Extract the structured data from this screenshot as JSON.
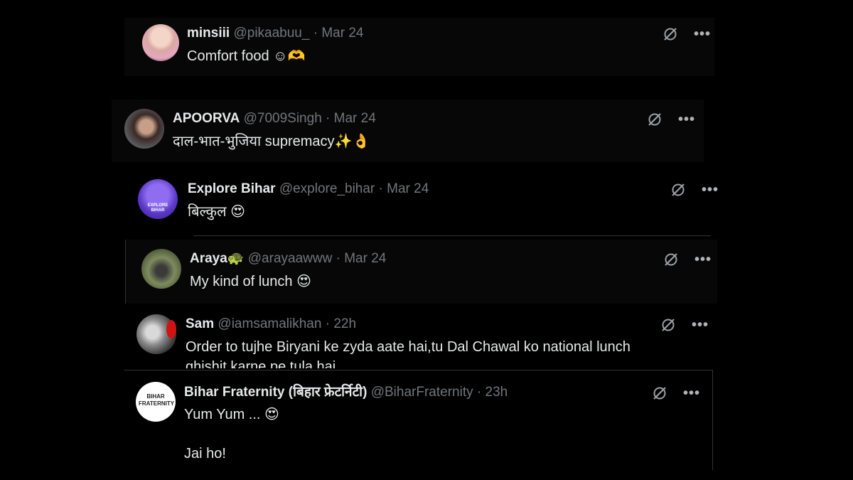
{
  "tweets": [
    {
      "name": "minsiii",
      "handle": "@pikaabuu_",
      "sep": "·",
      "date": "Mar 24",
      "text": "Comfort food ☺🫶",
      "more": "•••"
    },
    {
      "name": "APOORVA",
      "handle": "@7009Singh",
      "sep": "·",
      "date": "Mar 24",
      "text": "दाल-भात-भुजिया supremacy✨👌",
      "more": "•••"
    },
    {
      "name": "Explore Bihar",
      "handle": "@explore_bihar",
      "sep": "·",
      "date": "Mar 24",
      "text": "बिल्कुल 😍",
      "more": "•••",
      "avatar_text": "EXPLORE BIHAR"
    },
    {
      "name": "Araya🐢",
      "handle": "@arayaawww",
      "sep": "·",
      "date": "Mar 24",
      "text": "My kind of lunch 😍",
      "more": "•••"
    },
    {
      "name": "Sam",
      "handle": "@iamsamalikhan",
      "sep": "·",
      "date": "22h",
      "text": "Order to tujhe Biryani ke zyda aate hai,tu Dal Chawal ko national lunch",
      "text2": "ghishit karne pe tula hai",
      "more": "•••"
    },
    {
      "name": "Bihar Fraternity (बिहार फ्रेटर्निटी)",
      "handle": "@BiharFraternity",
      "sep": "·",
      "date": "23h",
      "text": "Yum Yum ... 😍",
      "text2": "Jai ho!",
      "more": "•••",
      "avatar_text": "BIHAR FRATERNITY"
    }
  ],
  "colors": {
    "background": "#000000",
    "name": "#e7e9ea",
    "handle": "#71767b",
    "border": "#2f3336"
  }
}
